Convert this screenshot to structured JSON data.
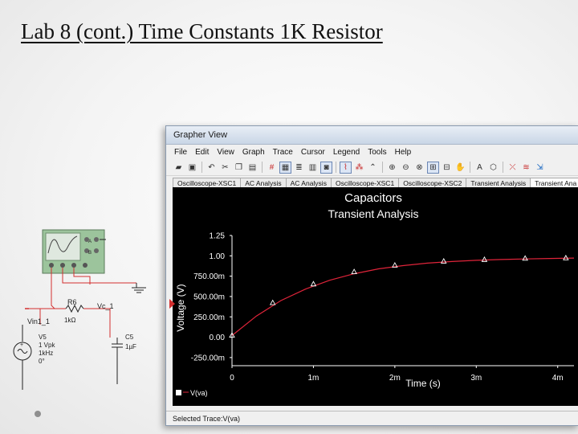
{
  "slide": {
    "title": "Lab 8 (cont.) Time Constants 1K Resistor"
  },
  "circuit": {
    "resistor_ref": "R6",
    "resistor_value": "1kΩ",
    "node_label": "Vc_1",
    "input_label": "Vin1_1",
    "source_ref": "V5",
    "source_amp": "1 Vpk",
    "source_freq": "1kHz",
    "source_phase": "0°",
    "cap_ref": "C5",
    "cap_value": "1µF",
    "scope_ch_a": "A",
    "scope_ch_b": "B"
  },
  "window": {
    "title": "Grapher View",
    "menu": [
      "File",
      "Edit",
      "View",
      "Graph",
      "Trace",
      "Cursor",
      "Legend",
      "Tools",
      "Help"
    ],
    "tabs": [
      {
        "label": "Oscilloscope-XSC1",
        "active": false
      },
      {
        "label": "AC Analysis",
        "active": false
      },
      {
        "label": "AC Analysis",
        "active": false
      },
      {
        "label": "Oscilloscope-XSC1",
        "active": false
      },
      {
        "label": "Oscilloscope-XSC2",
        "active": false
      },
      {
        "label": "Transient Analysis",
        "active": false
      },
      {
        "label": "Transient Ana",
        "active": true
      }
    ],
    "status": "Selected Trace:V(va)"
  },
  "toolbar": {
    "buttons": [
      {
        "name": "open-icon",
        "glyph": "▰"
      },
      {
        "name": "save-icon",
        "glyph": "▣"
      },
      {
        "name": "sep"
      },
      {
        "name": "undo-icon",
        "glyph": "↶"
      },
      {
        "name": "cut-icon",
        "glyph": "✂"
      },
      {
        "name": "copy-icon",
        "glyph": "❐"
      },
      {
        "name": "paste-icon",
        "glyph": "▤"
      },
      {
        "name": "sep"
      },
      {
        "name": "grid-icon",
        "glyph": "#",
        "style": "red"
      },
      {
        "name": "toggle-grid-icon",
        "glyph": "▦",
        "style": "active"
      },
      {
        "name": "legend-icon",
        "glyph": "≣"
      },
      {
        "name": "properties-icon",
        "glyph": "▥"
      },
      {
        "name": "background-icon",
        "glyph": "◙",
        "style": "active"
      },
      {
        "name": "sep"
      },
      {
        "name": "cursor-icon",
        "glyph": "⌇",
        "style": "active red"
      },
      {
        "name": "data-marker-icon",
        "glyph": "⁂",
        "style": "red"
      },
      {
        "name": "overlay-icon",
        "glyph": "⌃"
      },
      {
        "name": "sep"
      },
      {
        "name": "zoom-area-icon",
        "glyph": "⊕"
      },
      {
        "name": "zoom-out-icon",
        "glyph": "⊖"
      },
      {
        "name": "zoom-x-icon",
        "glyph": "⊗"
      },
      {
        "name": "zoom-full-icon",
        "glyph": "⊞",
        "style": "active"
      },
      {
        "name": "zoom-y-icon",
        "glyph": "⊟"
      },
      {
        "name": "pan-icon",
        "glyph": "✋"
      },
      {
        "name": "sep"
      },
      {
        "name": "text-icon",
        "glyph": "A"
      },
      {
        "name": "hex-icon",
        "glyph": "⬡"
      },
      {
        "name": "sep"
      },
      {
        "name": "add-trace-icon",
        "glyph": "⤫",
        "style": "red"
      },
      {
        "name": "measure-icon",
        "glyph": "≋",
        "style": "red"
      },
      {
        "name": "export-icon",
        "glyph": "⇲",
        "style": "blue"
      }
    ]
  },
  "chart_data": {
    "type": "line",
    "title": "Capacitors",
    "subtitle": "Transient Analysis",
    "xlabel": "Time (s)",
    "ylabel": "Voltage (V)",
    "xlim": [
      0,
      0.0042
    ],
    "ylim": [
      -0.35,
      1.25
    ],
    "xticks": [
      0,
      0.001,
      0.002,
      0.003,
      0.004
    ],
    "xtick_labels": [
      "0",
      "1m",
      "2m",
      "3m",
      "4m"
    ],
    "yticks": [
      -0.25,
      0,
      0.25,
      0.5,
      0.75,
      1.0,
      1.25
    ],
    "ytick_labels": [
      "-250.00m",
      "0.00",
      "250.00m",
      "500.00m",
      "750.00m",
      "1.00",
      "1.25"
    ],
    "grid": false,
    "legend_position": "bottom-left",
    "series": [
      {
        "name": "V(va)",
        "color": "#e0243a",
        "marker_color": "#ffffff",
        "x": [
          0,
          0.0003,
          0.0006,
          0.0009,
          0.0012,
          0.0015,
          0.0018,
          0.0021,
          0.0024,
          0.0027,
          0.003,
          0.0033,
          0.0036,
          0.0039,
          0.0042
        ],
        "y": [
          0.02,
          0.26,
          0.45,
          0.59,
          0.7,
          0.78,
          0.84,
          0.88,
          0.91,
          0.93,
          0.945,
          0.955,
          0.962,
          0.968,
          0.972
        ]
      }
    ],
    "markers": {
      "x": [
        0,
        0.0005,
        0.001,
        0.0015,
        0.002,
        0.0026,
        0.0031,
        0.0036,
        0.0041
      ],
      "y": [
        0.02,
        0.42,
        0.65,
        0.8,
        0.88,
        0.93,
        0.95,
        0.965,
        0.97
      ]
    }
  }
}
